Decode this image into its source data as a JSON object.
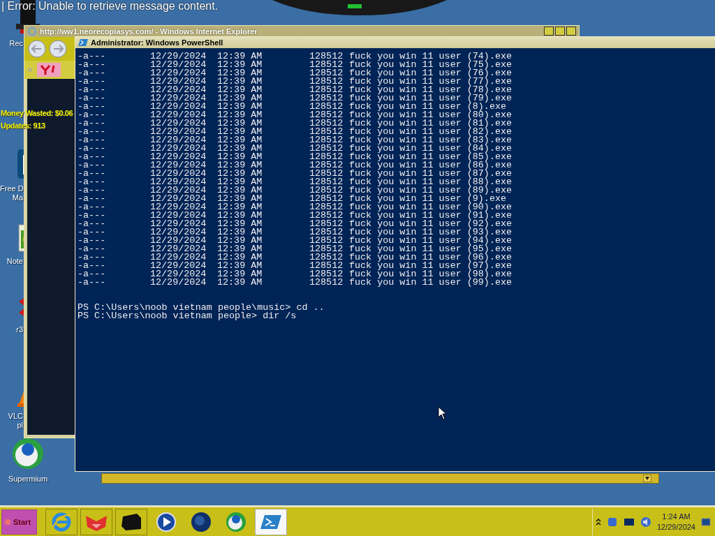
{
  "banner": {
    "text": "| Error: Unable to retrieve message content."
  },
  "overlay": {
    "money": "Money Wasted: $0.06",
    "updates": "Updates: 913"
  },
  "desktop_icons": [
    {
      "kind": "bin",
      "label": "Rec"
    },
    {
      "kind": "doc",
      "label": "Free D\nMa"
    },
    {
      "kind": "note",
      "label": "Note"
    },
    {
      "kind": "red",
      "label": "r3"
    },
    {
      "kind": "cone",
      "label": "VLC\npl"
    },
    {
      "kind": "globe",
      "label": "Supermium"
    }
  ],
  "browser": {
    "title": "http://ww1.neorecopiasys.com/ - Windows Internet Explorer"
  },
  "console": {
    "title": "Administrator: Windows PowerShell",
    "rows": [
      {
        "mode": "-a---",
        "date": "12/29/2024",
        "time": "12:39 AM",
        "length": "128512",
        "name": "fuck you win 11 user (74).exe"
      },
      {
        "mode": "-a---",
        "date": "12/29/2024",
        "time": "12:39 AM",
        "length": "128512",
        "name": "fuck you win 11 user (75).exe"
      },
      {
        "mode": "-a---",
        "date": "12/29/2024",
        "time": "12:39 AM",
        "length": "128512",
        "name": "fuck you win 11 user (76).exe"
      },
      {
        "mode": "-a---",
        "date": "12/29/2024",
        "time": "12:39 AM",
        "length": "128512",
        "name": "fuck you win 11 user (77).exe"
      },
      {
        "mode": "-a---",
        "date": "12/29/2024",
        "time": "12:39 AM",
        "length": "128512",
        "name": "fuck you win 11 user (78).exe"
      },
      {
        "mode": "-a---",
        "date": "12/29/2024",
        "time": "12:39 AM",
        "length": "128512",
        "name": "fuck you win 11 user (79).exe"
      },
      {
        "mode": "-a---",
        "date": "12/29/2024",
        "time": "12:39 AM",
        "length": "128512",
        "name": "fuck you win 11 user (8).exe"
      },
      {
        "mode": "-a---",
        "date": "12/29/2024",
        "time": "12:39 AM",
        "length": "128512",
        "name": "fuck you win 11 user (80).exe"
      },
      {
        "mode": "-a---",
        "date": "12/29/2024",
        "time": "12:39 AM",
        "length": "128512",
        "name": "fuck you win 11 user (81).exe"
      },
      {
        "mode": "-a---",
        "date": "12/29/2024",
        "time": "12:39 AM",
        "length": "128512",
        "name": "fuck you win 11 user (82).exe"
      },
      {
        "mode": "-a---",
        "date": "12/29/2024",
        "time": "12:39 AM",
        "length": "128512",
        "name": "fuck you win 11 user (83).exe"
      },
      {
        "mode": "-a---",
        "date": "12/29/2024",
        "time": "12:39 AM",
        "length": "128512",
        "name": "fuck you win 11 user (84).exe"
      },
      {
        "mode": "-a---",
        "date": "12/29/2024",
        "time": "12:39 AM",
        "length": "128512",
        "name": "fuck you win 11 user (85).exe"
      },
      {
        "mode": "-a---",
        "date": "12/29/2024",
        "time": "12:39 AM",
        "length": "128512",
        "name": "fuck you win 11 user (86).exe"
      },
      {
        "mode": "-a---",
        "date": "12/29/2024",
        "time": "12:39 AM",
        "length": "128512",
        "name": "fuck you win 11 user (87).exe"
      },
      {
        "mode": "-a---",
        "date": "12/29/2024",
        "time": "12:39 AM",
        "length": "128512",
        "name": "fuck you win 11 user (88).exe"
      },
      {
        "mode": "-a---",
        "date": "12/29/2024",
        "time": "12:39 AM",
        "length": "128512",
        "name": "fuck you win 11 user (89).exe"
      },
      {
        "mode": "-a---",
        "date": "12/29/2024",
        "time": "12:39 AM",
        "length": "128512",
        "name": "fuck you win 11 user (9).exe"
      },
      {
        "mode": "-a---",
        "date": "12/29/2024",
        "time": "12:39 AM",
        "length": "128512",
        "name": "fuck you win 11 user (90).exe"
      },
      {
        "mode": "-a---",
        "date": "12/29/2024",
        "time": "12:39 AM",
        "length": "128512",
        "name": "fuck you win 11 user (91).exe"
      },
      {
        "mode": "-a---",
        "date": "12/29/2024",
        "time": "12:39 AM",
        "length": "128512",
        "name": "fuck you win 11 user (92).exe"
      },
      {
        "mode": "-a---",
        "date": "12/29/2024",
        "time": "12:39 AM",
        "length": "128512",
        "name": "fuck you win 11 user (93).exe"
      },
      {
        "mode": "-a---",
        "date": "12/29/2024",
        "time": "12:39 AM",
        "length": "128512",
        "name": "fuck you win 11 user (94).exe"
      },
      {
        "mode": "-a---",
        "date": "12/29/2024",
        "time": "12:39 AM",
        "length": "128512",
        "name": "fuck you win 11 user (95).exe"
      },
      {
        "mode": "-a---",
        "date": "12/29/2024",
        "time": "12:39 AM",
        "length": "128512",
        "name": "fuck you win 11 user (96).exe"
      },
      {
        "mode": "-a---",
        "date": "12/29/2024",
        "time": "12:39 AM",
        "length": "128512",
        "name": "fuck you win 11 user (97).exe"
      },
      {
        "mode": "-a---",
        "date": "12/29/2024",
        "time": "12:39 AM",
        "length": "128512",
        "name": "fuck you win 11 user (98).exe"
      },
      {
        "mode": "-a---",
        "date": "12/29/2024",
        "time": "12:39 AM",
        "length": "128512",
        "name": "fuck you win 11 user (99).exe"
      }
    ],
    "prompts": [
      "PS C:\\Users\\noob vietnam people\\music> cd ..",
      "PS C:\\Users\\noob vietnam people> dir /s"
    ]
  },
  "taskbar": {
    "start": "Start",
    "apps": [
      {
        "kind": "ie",
        "selected": false
      },
      {
        "kind": "fox",
        "selected": false
      },
      {
        "kind": "box",
        "selected": false
      },
      {
        "kind": "play",
        "selected": false
      },
      {
        "kind": "orb",
        "selected": false
      },
      {
        "kind": "globe",
        "selected": false
      },
      {
        "kind": "shell",
        "selected": true
      }
    ],
    "time": "1:24 AM",
    "date": "12/29/2024"
  }
}
